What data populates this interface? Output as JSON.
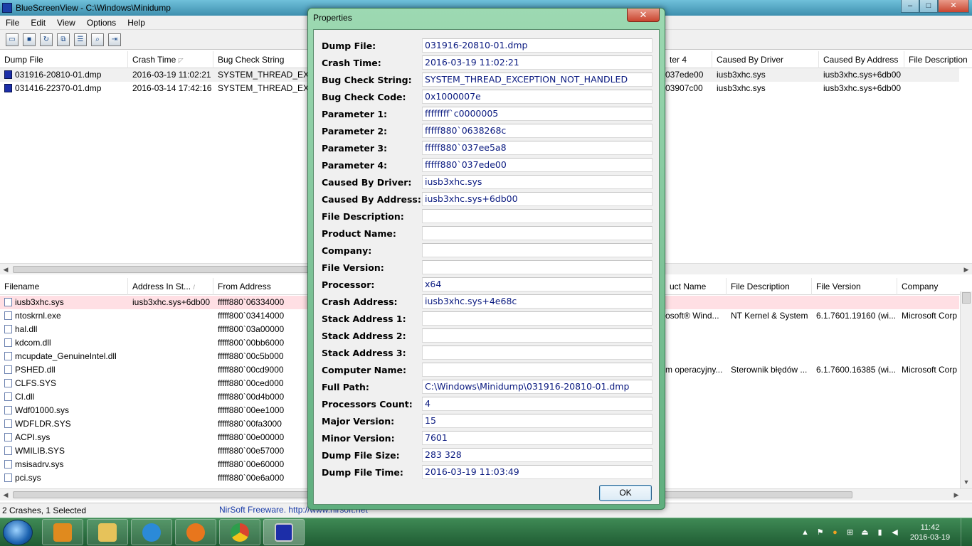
{
  "window": {
    "title": "BlueScreenView - C:\\Windows\\Minidump",
    "min": "–",
    "max": "□",
    "close": "✕"
  },
  "menu": [
    "File",
    "Edit",
    "View",
    "Options",
    "Help"
  ],
  "toolbar_icons": [
    "save-icon",
    "save-selected-icon",
    "refresh-icon",
    "copy-icon",
    "properties-icon",
    "find-icon",
    "exit-icon"
  ],
  "upper_grid": {
    "columns": [
      "Dump File",
      "Crash Time",
      "Bug Check String",
      "Parameter 4",
      "Caused By Driver",
      "Caused By Address",
      "File Description"
    ],
    "param4_header_visible": "ter 4",
    "rows": [
      {
        "file": "031916-20810-01.dmp",
        "time": "2016-03-19 11:02:21",
        "bug": "SYSTEM_THREAD_EXCE",
        "p4": "037ede00",
        "driver": "iusb3xhc.sys",
        "address": "iusb3xhc.sys+6db00"
      },
      {
        "file": "031416-22370-01.dmp",
        "time": "2016-03-14 17:42:16",
        "bug": "SYSTEM_THREAD_EXCE",
        "p4": "03907c00",
        "driver": "iusb3xhc.sys",
        "address": "iusb3xhc.sys+6db00"
      }
    ]
  },
  "lower_grid": {
    "columns": [
      "Filename",
      "Address In St...",
      "From Address",
      "uct Name",
      "File Description",
      "File Version",
      "Company"
    ],
    "rows": [
      {
        "name": "iusb3xhc.sys",
        "addr": "iusb3xhc.sys+6db00",
        "from": "fffff880`06334000",
        "pname": "",
        "desc": "",
        "ver": "",
        "company": ""
      },
      {
        "name": "ntoskrnl.exe",
        "addr": "",
        "from": "fffff800`03414000",
        "pname": "osoft® Wind...",
        "desc": "NT Kernel & System",
        "ver": "6.1.7601.19160 (wi...",
        "company": "Microsoft Corp"
      },
      {
        "name": "hal.dll",
        "addr": "",
        "from": "fffff800`03a00000",
        "pname": "",
        "desc": "",
        "ver": "",
        "company": ""
      },
      {
        "name": "kdcom.dll",
        "addr": "",
        "from": "fffff800`00bb6000",
        "pname": "",
        "desc": "",
        "ver": "",
        "company": ""
      },
      {
        "name": "mcupdate_GenuineIntel.dll",
        "addr": "",
        "from": "fffff880`00c5b000",
        "pname": "",
        "desc": "",
        "ver": "",
        "company": ""
      },
      {
        "name": "PSHED.dll",
        "addr": "",
        "from": "fffff880`00cd9000",
        "pname": "m operacyjny...",
        "desc": "Sterownik błędów ...",
        "ver": "6.1.7600.16385 (wi...",
        "company": "Microsoft Corp"
      },
      {
        "name": "CLFS.SYS",
        "addr": "",
        "from": "fffff880`00ced000",
        "pname": "",
        "desc": "",
        "ver": "",
        "company": ""
      },
      {
        "name": "CI.dll",
        "addr": "",
        "from": "fffff880`00d4b000",
        "pname": "",
        "desc": "",
        "ver": "",
        "company": ""
      },
      {
        "name": "Wdf01000.sys",
        "addr": "",
        "from": "fffff880`00ee1000",
        "pname": "",
        "desc": "",
        "ver": "",
        "company": ""
      },
      {
        "name": "WDFLDR.SYS",
        "addr": "",
        "from": "fffff880`00fa3000",
        "pname": "",
        "desc": "",
        "ver": "",
        "company": ""
      },
      {
        "name": "ACPI.sys",
        "addr": "",
        "from": "fffff880`00e00000",
        "pname": "",
        "desc": "",
        "ver": "",
        "company": ""
      },
      {
        "name": "WMILIB.SYS",
        "addr": "",
        "from": "fffff880`00e57000",
        "pname": "",
        "desc": "",
        "ver": "",
        "company": ""
      },
      {
        "name": "msisadrv.sys",
        "addr": "",
        "from": "fffff880`00e60000",
        "pname": "",
        "desc": "",
        "ver": "",
        "company": ""
      },
      {
        "name": "pci.sys",
        "addr": "",
        "from": "fffff880`00e6a000",
        "pname": "",
        "desc": "",
        "ver": "",
        "company": ""
      }
    ]
  },
  "status": {
    "left": "2 Crashes, 1 Selected",
    "link": "NirSoft Freeware.  http://www.nirsoft.net"
  },
  "dialog": {
    "title": "Properties",
    "close": "✕",
    "ok": "OK",
    "rows": [
      {
        "label": "Dump File:",
        "value": "031916-20810-01.dmp"
      },
      {
        "label": "Crash Time:",
        "value": "2016-03-19 11:02:21"
      },
      {
        "label": "Bug Check String:",
        "value": "SYSTEM_THREAD_EXCEPTION_NOT_HANDLED"
      },
      {
        "label": "Bug Check Code:",
        "value": "0x1000007e"
      },
      {
        "label": "Parameter 1:",
        "value": "ffffffff`c0000005"
      },
      {
        "label": "Parameter 2:",
        "value": "fffff880`0638268c"
      },
      {
        "label": "Parameter 3:",
        "value": "fffff880`037ee5a8"
      },
      {
        "label": "Parameter 4:",
        "value": "fffff880`037ede00"
      },
      {
        "label": "Caused By Driver:",
        "value": "iusb3xhc.sys"
      },
      {
        "label": "Caused By Address:",
        "value": "iusb3xhc.sys+6db00"
      },
      {
        "label": "File Description:",
        "value": ""
      },
      {
        "label": "Product Name:",
        "value": ""
      },
      {
        "label": "Company:",
        "value": ""
      },
      {
        "label": "File Version:",
        "value": ""
      },
      {
        "label": "Processor:",
        "value": "x64"
      },
      {
        "label": "Crash Address:",
        "value": "iusb3xhc.sys+4e68c"
      },
      {
        "label": "Stack Address 1:",
        "value": ""
      },
      {
        "label": "Stack Address 2:",
        "value": ""
      },
      {
        "label": "Stack Address 3:",
        "value": ""
      },
      {
        "label": "Computer Name:",
        "value": ""
      },
      {
        "label": "Full Path:",
        "value": "C:\\Windows\\Minidump\\031916-20810-01.dmp"
      },
      {
        "label": "Processors Count:",
        "value": "4"
      },
      {
        "label": "Major Version:",
        "value": "15"
      },
      {
        "label": "Minor Version:",
        "value": "7601"
      },
      {
        "label": "Dump File Size:",
        "value": "283 328"
      },
      {
        "label": "Dump File Time:",
        "value": "2016-03-19 11:03:49"
      }
    ]
  },
  "taskbar": {
    "apps": [
      {
        "name": "media-player",
        "color": "#e08a1e"
      },
      {
        "name": "explorer",
        "color": "#e6c25a"
      },
      {
        "name": "internet-explorer",
        "color": "#2b8ad8"
      },
      {
        "name": "firefox",
        "color": "#e8761d"
      },
      {
        "name": "chrome",
        "color": "#d9442f"
      },
      {
        "name": "bluescreenview",
        "color": "#1c2ea8"
      }
    ],
    "time": "11:42",
    "date": "2016-03-19"
  },
  "colors": {
    "dialog_frame": "#7fc99a",
    "value_text": "#0a1a80",
    "taskbar": "#2a6b3f",
    "selected_row": "#ffdfe4"
  }
}
